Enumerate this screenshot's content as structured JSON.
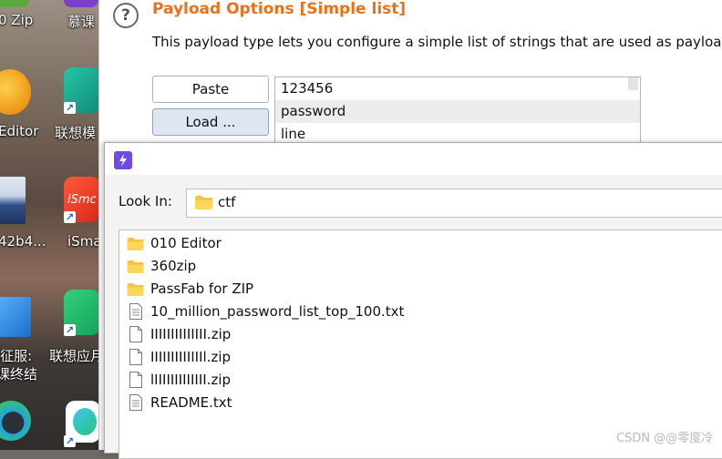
{
  "desktop": {
    "labels": [
      "0 Zip",
      "慕课",
      "Editor",
      "联想模",
      "42b4...",
      "iSma",
      "i征服:",
      "联想应月",
      "课终结"
    ],
    "logo_text": "iSmc"
  },
  "burp": {
    "help_glyph": "?",
    "title": "Payload Options [Simple list]",
    "description": "This payload type lets you configure a simple list of strings that are used as payloa",
    "paste_label": "Paste",
    "load_label": "Load ...",
    "list_items": [
      "123456",
      "password",
      "line"
    ],
    "selected_item_index": 1,
    "accent_color": "#e8711c"
  },
  "dialog": {
    "lookin_label": "Look In:",
    "lookin_value": "ctf",
    "files": [
      {
        "name": "010 Editor",
        "kind": "folder"
      },
      {
        "name": "360zip",
        "kind": "folder"
      },
      {
        "name": "PassFab for ZIP",
        "kind": "folder"
      },
      {
        "name": "10_million_password_list_top_100.txt",
        "kind": "text"
      },
      {
        "name": "IIIIIIIIIIIIII.zip",
        "kind": "file"
      },
      {
        "name": "IIIIIIIIIIIIIl.zip",
        "kind": "file"
      },
      {
        "name": "lIIIIIIIIIIIII.zip",
        "kind": "file"
      },
      {
        "name": "README.txt",
        "kind": "text"
      }
    ]
  },
  "watermark": "CSDN @@零度冷"
}
